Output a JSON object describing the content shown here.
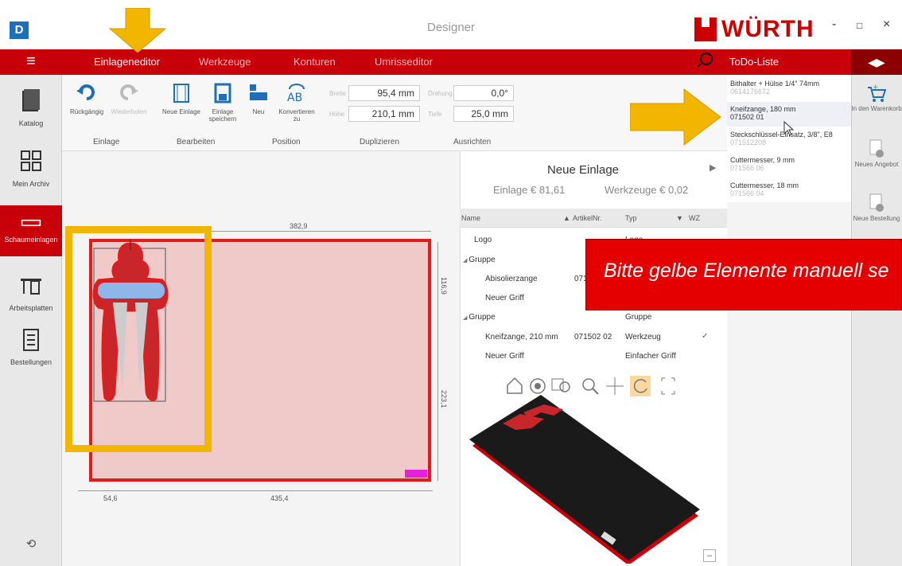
{
  "app": {
    "title": "Designer",
    "logo_letter": "D",
    "brand": "WÜRTH"
  },
  "window_controls": {
    "minimize": "-",
    "maximize": "□",
    "close": "×"
  },
  "menu": {
    "items": [
      {
        "label": "Einlageneditor",
        "active": true
      },
      {
        "label": "Werkzeuge",
        "active": false
      },
      {
        "label": "Konturen",
        "active": false
      },
      {
        "label": "Umrisseditor",
        "active": false
      }
    ],
    "todo_label": "ToDo-Liste",
    "collapse_icon": "◀▶"
  },
  "sidebar": {
    "items": [
      {
        "label": "Katalog"
      },
      {
        "label": "Mein Archiv"
      },
      {
        "label": "Schaumeinlagen",
        "active": true
      },
      {
        "label": "Arbeitsplatten"
      },
      {
        "label": "Bestellungen"
      }
    ],
    "bottom_icon": "⟲"
  },
  "ribbon": {
    "undo": "Rückgängig",
    "redo": "Wiederholen",
    "new_insert": "Neue Einlage",
    "save_insert": "Einlage speichern",
    "new": "Neu",
    "convert": "Konvertieren zu",
    "width_label": "Breite",
    "width_value": "95,4 mm",
    "height_label": "Höhe",
    "height_value": "210,1 mm",
    "rotation_label": "Drehung",
    "rotation_value": "0,0°",
    "depth_label": "Tiefe",
    "depth_value": "25,0 mm",
    "groups": [
      "Einlage",
      "Bearbeiten",
      "Position",
      "Duplizieren",
      "Ausrichten"
    ]
  },
  "canvas": {
    "dim_top": "382,9",
    "dim_right_top": "116,9",
    "dim_right_bottom": "223,1",
    "dim_bottom_left": "54,6",
    "dim_bottom_right": "435,4"
  },
  "panel": {
    "title": "Neue Einlage",
    "insert_price": "Einlage € 81,61",
    "tools_price": "Werkzeuge € 0,02",
    "columns": [
      "Name",
      "ArtikelNr.",
      "Typ",
      "WZ"
    ],
    "rows": [
      {
        "name": "Logo",
        "article": "",
        "type": "Logo"
      },
      {
        "name": "Gruppe",
        "article": "",
        "type": ""
      },
      {
        "name": "Abisolierzange",
        "article": "071",
        "type": ""
      },
      {
        "name": "Neuer Griff",
        "article": "",
        "type": ""
      },
      {
        "name": "Gruppe",
        "article": "",
        "type": "Gruppe"
      },
      {
        "name": "Kneifzange, 210 mm",
        "article": "071502 02",
        "type": "Werkzeug",
        "check": "✓"
      },
      {
        "name": "Neuer Griff",
        "article": "",
        "type": "Einfacher Griff"
      }
    ]
  },
  "todo": [
    {
      "title": "Bithalter + Hülse 1/4\" 74mm",
      "article": "0614176672"
    },
    {
      "title": "Kneifzange, 180 mm",
      "article": "071502 01"
    },
    {
      "title": "Steckschlüssel-Einsatz, 3/8\", E8",
      "article": "071512208"
    },
    {
      "title": "Cuttermesser, 9 mm",
      "article": "071566 06"
    },
    {
      "title": "Cuttermesser, 18 mm",
      "article": "071566 04"
    }
  ],
  "right_sidebar": [
    {
      "label": "In den Warenkorb"
    },
    {
      "label": "Neues Angebot"
    },
    {
      "label": "Neue Bestellung"
    }
  ],
  "banner": "Bitte gelbe Elemente manuell se",
  "minimize_box": "–",
  "colors": {
    "brand_red": "#c8000a",
    "highlight_yellow": "#f2b500",
    "magenta_marker": "#e61fd9"
  }
}
